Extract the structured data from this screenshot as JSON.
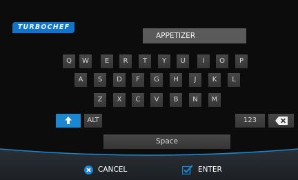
{
  "brand": {
    "logo_text": "TURBOCHEF"
  },
  "input": {
    "value": "APPETIZER"
  },
  "keyboard": {
    "row1": [
      "Q",
      "W",
      "E",
      "R",
      "T",
      "Y",
      "U",
      "I",
      "O",
      "P"
    ],
    "row2": [
      "A",
      "S",
      "D",
      "F",
      "G",
      "H",
      "J",
      "K",
      "L"
    ],
    "row3": [
      "Z",
      "X",
      "C",
      "V",
      "B",
      "N",
      "M"
    ],
    "alt_label": "ALT",
    "numbers_label": "123",
    "space_label": "Space"
  },
  "actions": {
    "cancel_label": "CANCEL",
    "enter_label": "ENTER"
  },
  "colors": {
    "accent": "#1a87d0",
    "background": "#0c0c0c",
    "key": "#3f3f3f",
    "field": "#5a5a5a"
  }
}
